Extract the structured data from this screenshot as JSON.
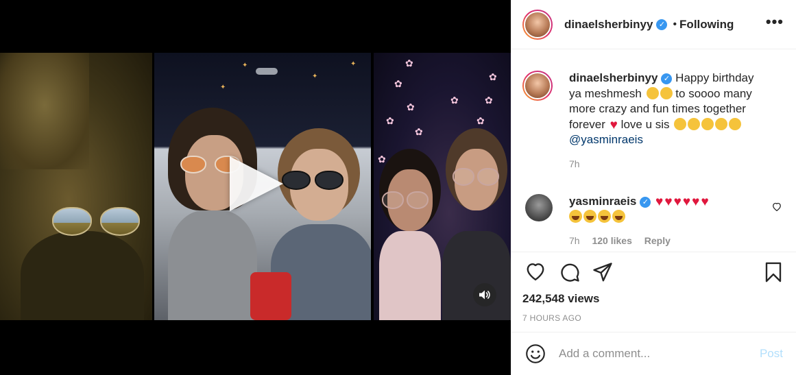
{
  "post": {
    "username": "dinaelsherbinyy",
    "follow_separator": "•",
    "follow_status": "Following",
    "more_label": "•••"
  },
  "caption": {
    "username": "dinaelsherbinyy",
    "text_1": "Happy birthday ya meshmesh",
    "text_2": "to soooo many more crazy and fun times together forever",
    "text_3": "love u sis",
    "mention": "@yasminraeis",
    "time": "7h"
  },
  "reply": {
    "username": "yasminraeis",
    "time": "7h",
    "likes": "120 likes",
    "reply_label": "Reply"
  },
  "stats": {
    "views": "242,548 views",
    "timestamp": "7 HOURS AGO"
  },
  "add_comment": {
    "placeholder": "Add a comment...",
    "post_label": "Post"
  },
  "colors": {
    "verified": "#3897f0",
    "post_disabled": "#b2dffc",
    "mention": "#00376b"
  }
}
